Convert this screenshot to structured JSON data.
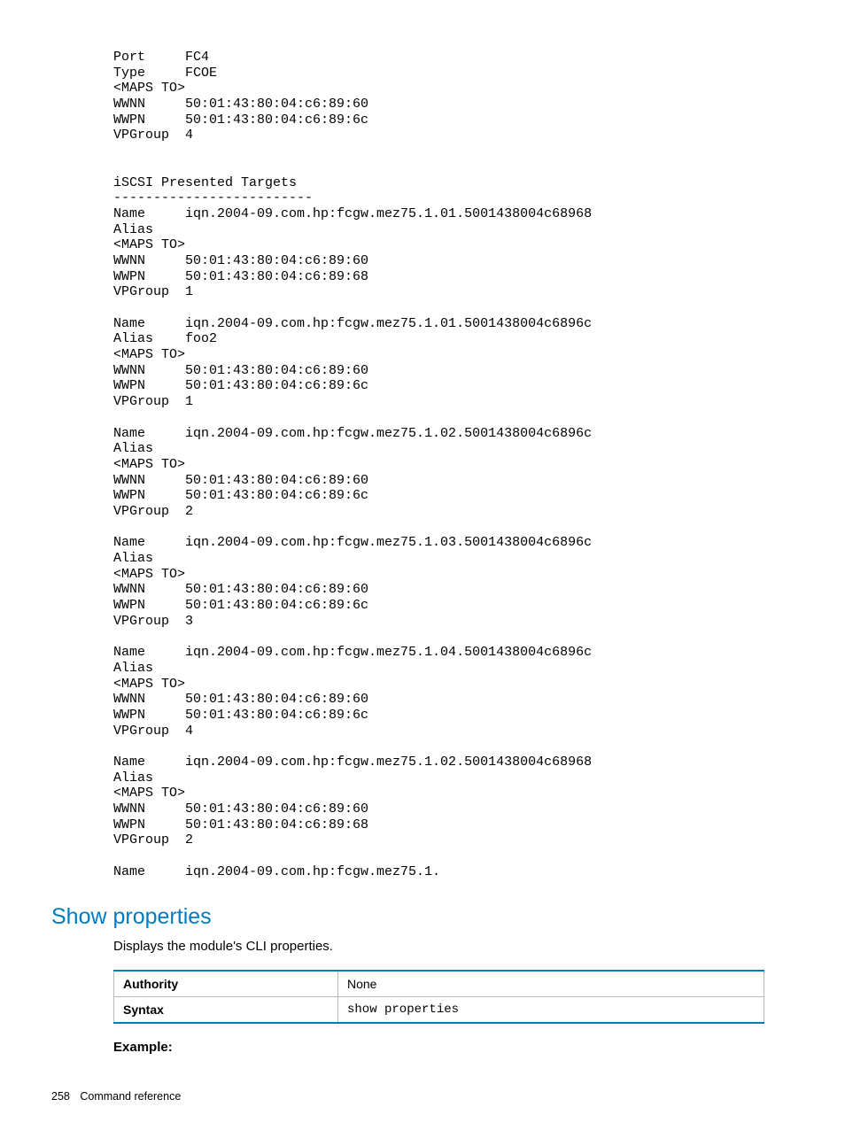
{
  "cli_output": "Port     FC4\nType     FCOE\n<MAPS TO>\nWWNN     50:01:43:80:04:c6:89:60\nWWPN     50:01:43:80:04:c6:89:6c\nVPGroup  4\n\n\niSCSI Presented Targets\n-------------------------\nName     iqn.2004-09.com.hp:fcgw.mez75.1.01.5001438004c68968\nAlias\n<MAPS TO>\nWWNN     50:01:43:80:04:c6:89:60\nWWPN     50:01:43:80:04:c6:89:68\nVPGroup  1\n\nName     iqn.2004-09.com.hp:fcgw.mez75.1.01.5001438004c6896c\nAlias    foo2\n<MAPS TO>\nWWNN     50:01:43:80:04:c6:89:60\nWWPN     50:01:43:80:04:c6:89:6c\nVPGroup  1\n\nName     iqn.2004-09.com.hp:fcgw.mez75.1.02.5001438004c6896c\nAlias\n<MAPS TO>\nWWNN     50:01:43:80:04:c6:89:60\nWWPN     50:01:43:80:04:c6:89:6c\nVPGroup  2\n\nName     iqn.2004-09.com.hp:fcgw.mez75.1.03.5001438004c6896c\nAlias\n<MAPS TO>\nWWNN     50:01:43:80:04:c6:89:60\nWWPN     50:01:43:80:04:c6:89:6c\nVPGroup  3\n\nName     iqn.2004-09.com.hp:fcgw.mez75.1.04.5001438004c6896c\nAlias\n<MAPS TO>\nWWNN     50:01:43:80:04:c6:89:60\nWWPN     50:01:43:80:04:c6:89:6c\nVPGroup  4\n\nName     iqn.2004-09.com.hp:fcgw.mez75.1.02.5001438004c68968\nAlias\n<MAPS TO>\nWWNN     50:01:43:80:04:c6:89:60\nWWPN     50:01:43:80:04:c6:89:68\nVPGroup  2\n\nName     iqn.2004-09.com.hp:fcgw.mez75.1.",
  "section": {
    "title": "Show properties",
    "description": "Displays the module's CLI properties.",
    "table": {
      "authority_label": "Authority",
      "authority_value": "None",
      "syntax_label": "Syntax",
      "syntax_value": "show properties"
    },
    "example_label": "Example:"
  },
  "footer": {
    "page_number": "258",
    "chapter": "Command reference"
  }
}
